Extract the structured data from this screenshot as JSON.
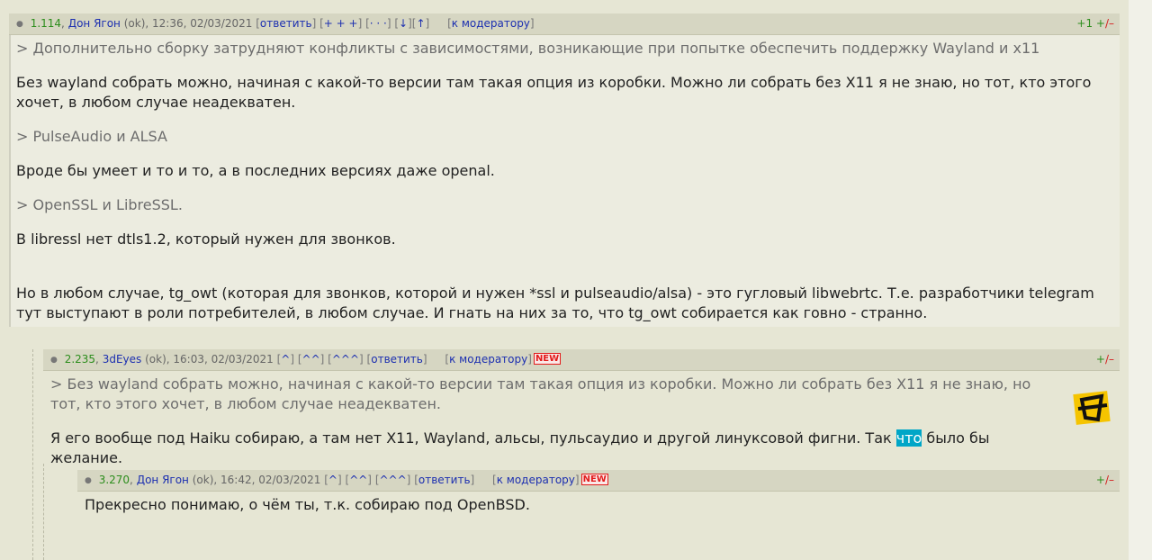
{
  "comments": [
    {
      "header": {
        "score": "1.114",
        "author": "Дон Ягон",
        "meta": "(ok), 12:36, 02/03/2021",
        "reply": "ответить",
        "plus_controls": "+ + +",
        "dots": "· · ·",
        "down": "↓",
        "up": "↑",
        "moderator": "к модератору",
        "vote_plus": "+1 +",
        "vote_minus": "/–"
      },
      "paragraphs": [
        "> Дополнительно сборку затрудняют конфликты с зависимостями, возникающие при попытке обеспечить поддержку Wayland и x11",
        "Без wayland собрать можно, начиная с какой-то версии там такая опция из коробки. Можно ли собрать без X11 я не знаю, но тот, кто этого хочет, в любом случае неадекватен.",
        "> PulseAudio и ALSA",
        "Вроде бы умеет и то и то, а в последних версиях даже openal.",
        "> OpenSSL и LibreSSL.",
        "В libressl нет dtls1.2, который нужен для звонков.",
        "Но в любом случае, tg_owt (которая для звонков, которой и нужен *ssl и pulseaudio/alsa) - это гугловый libwebrtc. Т.е. разработчики telegram тут выступают в роли потребителей, в любом случае. И гнать на них за то, что tg_owt собирается как говно - странно."
      ]
    },
    {
      "header": {
        "score": "2.235",
        "author": "3dEyes",
        "meta": "(ok), 16:03, 02/03/2021",
        "nav1": "^",
        "nav2": "^^",
        "nav3": "^^^",
        "reply": "ответить",
        "moderator": "к модератору",
        "new_badge": "NEW",
        "vote_plus": "+",
        "vote_minus": "/–"
      },
      "quote": "> Без wayland собрать можно, начиная с какой-то версии там такая опция из коробки. Можно ли собрать без X11 я не знаю, но тот, кто этого хочет, в любом случае неадекватен.",
      "text_before": "Я его вообще под Haiku собираю, а там нет X11, Wayland, альсы, пульсаудио и другой линуксовой фигни. Так ",
      "text_highlight": "что",
      "text_after": " было бы желание."
    },
    {
      "header": {
        "score": "3.270",
        "author": "Дон Ягон",
        "meta": "(ok), 16:42, 02/03/2021",
        "nav1": "^",
        "nav2": "^^",
        "nav3": "^^^",
        "reply": "ответить",
        "moderator": "к модератору",
        "new_badge": "NEW",
        "vote_plus": "+",
        "vote_minus": "/–"
      },
      "text": "Прекресно понимаю, о чём ты, т.к. собираю под OpenBSD."
    }
  ]
}
